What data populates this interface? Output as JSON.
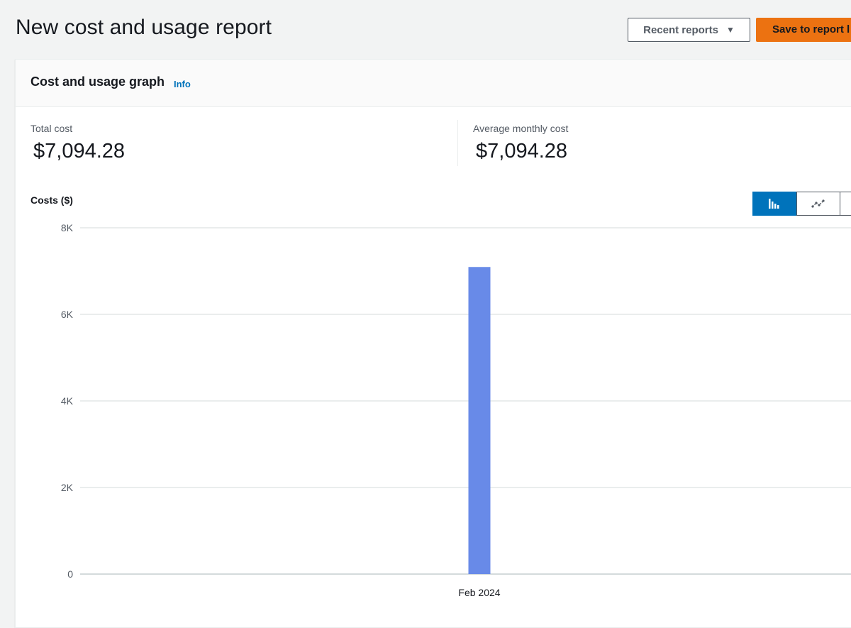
{
  "page": {
    "title": "New cost and usage report"
  },
  "header_actions": {
    "recent_reports_label": "Recent reports",
    "save_label": "Save to report l"
  },
  "panel": {
    "title": "Cost and usage graph",
    "info_label": "Info"
  },
  "metrics": {
    "total_cost_label": "Total cost",
    "total_cost_value": "$7,094.28",
    "avg_monthly_label": "Average monthly cost",
    "avg_monthly_value": "$7,094.28"
  },
  "chart_toggle": {
    "active": "bar",
    "options": [
      "bar-chart-icon",
      "line-chart-icon",
      "stacked-chart-icon"
    ]
  },
  "chart_data": {
    "type": "bar",
    "ylabel": "Costs ($)",
    "xlabel": "",
    "categories": [
      "Feb 2024"
    ],
    "values": [
      7094.28
    ],
    "ylim": [
      0,
      8000
    ],
    "yticks": [
      0,
      2000,
      4000,
      6000,
      8000
    ],
    "ytick_labels": [
      "0",
      "2K",
      "4K",
      "6K",
      "8K"
    ],
    "grid": true,
    "bar_color": "#688ae8"
  },
  "colors": {
    "accent": "#0073bb",
    "primary_button": "#ec7211",
    "bar": "#688ae8"
  }
}
